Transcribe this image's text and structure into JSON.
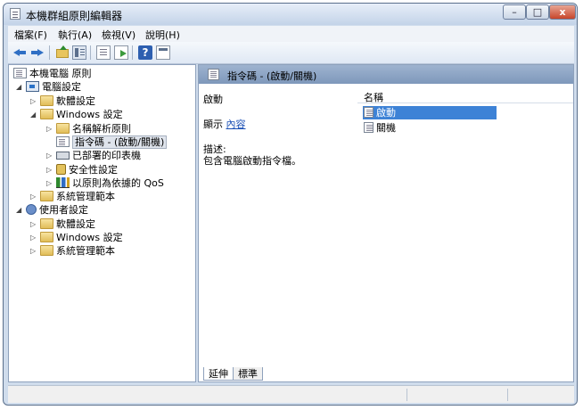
{
  "window": {
    "title": "本機群組原則編輯器"
  },
  "window_controls": {
    "minimize": "–",
    "maximize": "□",
    "close": "x"
  },
  "menu": [
    {
      "label": "檔案(F)"
    },
    {
      "label": "執行(A)"
    },
    {
      "label": "檢視(V)"
    },
    {
      "label": "說明(H)"
    }
  ],
  "toolbar": {
    "icons": [
      "back-arrow-icon",
      "forward-arrow-icon",
      "up-folder-icon",
      "show-tree-icon",
      "properties-icon",
      "export-list-icon",
      "help-icon",
      "view-icon"
    ],
    "help_glyph": "?"
  },
  "tree": {
    "root": "本機電腦 原則",
    "nodes": [
      {
        "label": "電腦設定",
        "expander": "◢"
      },
      {
        "label": "軟體設定",
        "expander": "▷"
      },
      {
        "label": "Windows 設定",
        "expander": "◢"
      },
      {
        "label": "名稱解析原則",
        "expander": "▷"
      },
      {
        "label": "指令碼 - (啟動/關機)",
        "expander": ""
      },
      {
        "label": "已部署的印表機",
        "expander": "▷"
      },
      {
        "label": "安全性設定",
        "expander": "▷"
      },
      {
        "label": "以原則為依據的 QoS",
        "expander": "▷"
      },
      {
        "label": "系統管理範本",
        "expander": "▷"
      },
      {
        "label": "使用者設定",
        "expander": "◢"
      },
      {
        "label": "軟體設定",
        "expander": "▷"
      },
      {
        "label": "Windows 設定",
        "expander": "▷"
      },
      {
        "label": "系統管理範本",
        "expander": "▷"
      }
    ]
  },
  "details": {
    "header_title": "指令碼 - (啟動/關機)",
    "setting_name": "啟動",
    "show_label": "顯示",
    "show_link": "內容",
    "description_label": "描述:",
    "description_text": "包含電腦啟動指令檔。"
  },
  "list": {
    "column_name": "名稱",
    "items": [
      {
        "label": "啟動",
        "selected": true
      },
      {
        "label": "關機",
        "selected": false
      }
    ]
  },
  "tabs": [
    {
      "label": "延伸",
      "active": true
    },
    {
      "label": "標準",
      "active": false
    }
  ],
  "colors": {
    "selection": "#3d82d6",
    "header": "#8fa6c6",
    "link": "#1a4fb5"
  }
}
